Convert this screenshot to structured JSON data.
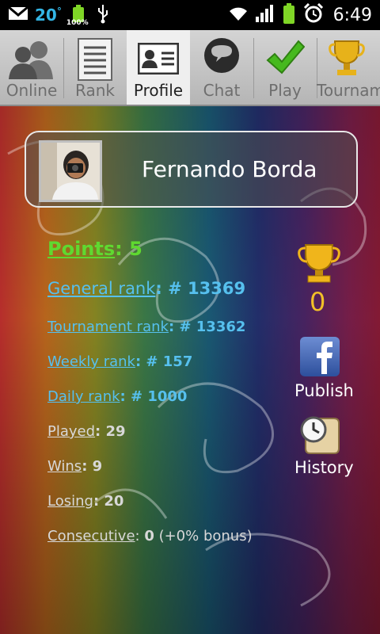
{
  "status_bar": {
    "temperature": "20",
    "temperature_unit": "°",
    "battery_small_label": "100%",
    "clock": "6:49",
    "icons": [
      "gmail-icon",
      "battery-full-icon",
      "usb-icon",
      "wifi-icon",
      "signal-icon",
      "battery-icon",
      "alarm-icon"
    ]
  },
  "tabs": [
    {
      "label": "Online",
      "icon": "people-icon"
    },
    {
      "label": "Rank",
      "icon": "list-icon"
    },
    {
      "label": "Profile",
      "icon": "id-card-icon",
      "selected": true
    },
    {
      "label": "Chat",
      "icon": "chat-bubble-icon"
    },
    {
      "label": "Play",
      "icon": "checkmark-icon"
    },
    {
      "label": "Tournam",
      "icon": "trophy-icon"
    }
  ],
  "profile": {
    "name": "Fernando Borda"
  },
  "stats": {
    "points_label": "Points",
    "points_value": ": 5",
    "general_rank_label": "General rank",
    "general_rank_value": ": # 13369",
    "tournament_rank_label": "Tournament rank",
    "tournament_rank_value": ": # 13362",
    "weekly_rank_label": "Weekly rank",
    "weekly_rank_value": ": # 157",
    "daily_rank_label": "Daily rank",
    "daily_rank_value": ": # 1000",
    "played_label": "Played",
    "played_value": ": 29",
    "wins_label": "Wins",
    "wins_value": ": 9",
    "losing_label": "Losing",
    "losing_value": ": 20",
    "consecutive_label": "Consecutive",
    "consecutive_sep": ": ",
    "consecutive_value": "0",
    "consecutive_bonus": " (+0% bonus)"
  },
  "side": {
    "trophies": "0",
    "publish_label": "Publish",
    "history_label": "History"
  },
  "colors": {
    "points_green": "#5fd930",
    "rank_blue": "#56c0ee",
    "trophy_gold": "#f2c028"
  }
}
